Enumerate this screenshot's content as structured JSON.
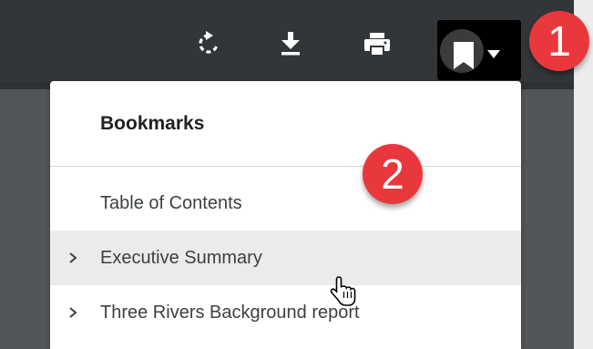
{
  "toolbar": {
    "icons": [
      "rotate-icon",
      "download-icon",
      "print-icon",
      "bookmark-icon"
    ],
    "bookmark_caret": "chevron-down-icon",
    "background": "#323639"
  },
  "badges": [
    {
      "label": "1",
      "color": "#e9383d"
    },
    {
      "label": "2",
      "color": "#e9383d"
    }
  ],
  "bookmarks_menu": {
    "title": "Bookmarks",
    "items": [
      {
        "label": "Table of Contents",
        "expandable": false,
        "hovered": false
      },
      {
        "label": "Executive Summary",
        "expandable": true,
        "hovered": true
      },
      {
        "label": "Three Rivers Background report",
        "expandable": true,
        "hovered": false
      }
    ]
  }
}
